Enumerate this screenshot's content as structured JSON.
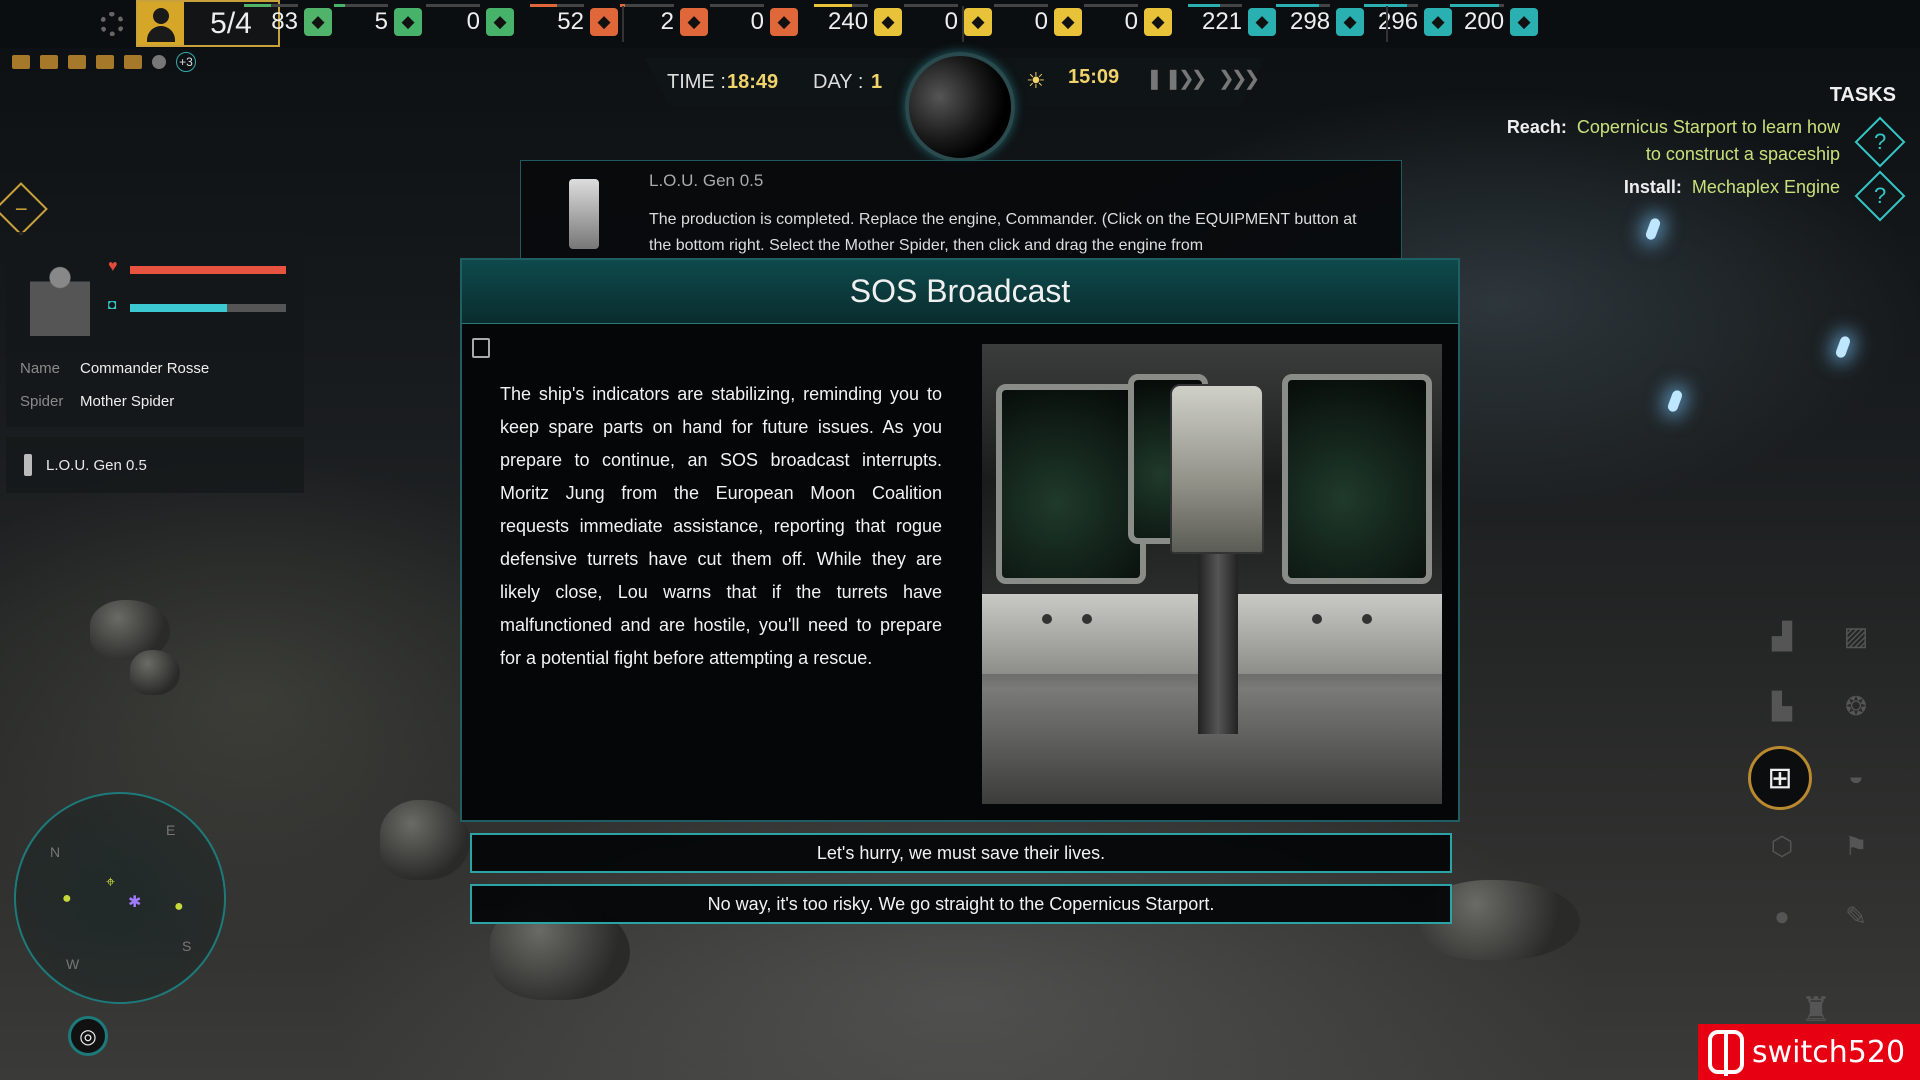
{
  "topbar": {
    "population": "5/4",
    "resources": [
      {
        "value": "83",
        "icon": "worker-icon",
        "color": "#4fb36a",
        "fill": 0.5
      },
      {
        "value": "5",
        "icon": "food-icon",
        "color": "#47b36a",
        "fill": 0.2
      },
      {
        "value": "0",
        "icon": "seed-icon",
        "color": "#47b36a",
        "fill": 0.0
      },
      {
        "value": "52",
        "icon": "ore-icon",
        "color": "#e0673a",
        "fill": 0.5
      },
      {
        "value": "2",
        "icon": "mineral-icon",
        "color": "#e0673a",
        "fill": 0.1
      },
      {
        "value": "0",
        "icon": "crystal-icon",
        "color": "#e0673a",
        "fill": 0.0
      },
      {
        "value": "240",
        "icon": "metal-icon",
        "color": "#e8c33a",
        "fill": 0.7
      },
      {
        "value": "0",
        "icon": "radiation-icon",
        "color": "#e8c33a",
        "fill": 0.0
      },
      {
        "value": "0",
        "icon": "tool-icon",
        "color": "#e8c33a",
        "fill": 0.0
      },
      {
        "value": "0",
        "icon": "cargo-icon",
        "color": "#e8c33a",
        "fill": 0.0
      },
      {
        "value": "221",
        "icon": "pipe-icon",
        "color": "#2ab0b0",
        "fill": 0.6
      },
      {
        "value": "298",
        "icon": "water-icon",
        "color": "#2ab0b0",
        "fill": 0.8
      },
      {
        "value": "296",
        "icon": "repair-icon",
        "color": "#2ab0b0",
        "fill": 0.8
      },
      {
        "value": "200",
        "icon": "battery-icon",
        "color": "#2ab0b0",
        "fill": 0.9
      }
    ],
    "notifications_more": "+3"
  },
  "time": {
    "time_label": "TIME :",
    "time_value": "18:49",
    "day_label": "DAY :",
    "day_value": "1",
    "sun_time": "15:09"
  },
  "tasks": {
    "title": "TASKS",
    "items": [
      {
        "key": "Reach:",
        "value": "Copernicus Starport to learn how",
        "value2": "to construct a spaceship"
      },
      {
        "key": "Install:",
        "value": "Mechaplex Engine"
      }
    ]
  },
  "character": {
    "hp": 1.0,
    "shield": 0.62,
    "name_label": "Name",
    "name_value": "Commander Rosse",
    "spider_label": "Spider",
    "spider_value": "Mother Spider",
    "unit": "L.O.U. Gen 0.5"
  },
  "preview": {
    "title": "L.O.U. Gen 0.5",
    "text": "The production is completed. Replace the engine, Commander. (Click on the EQUIPMENT button at the bottom right. Select the Mother Spider, then click and drag the engine from"
  },
  "dialog": {
    "title": "SOS Broadcast",
    "text": "The ship's indicators are stabilizing, reminding you to keep spare parts on hand for future issues. As you prepare to continue, an SOS broadcast interrupts. Moritz Jung from the European Moon Coalition requests immediate assistance, reporting that rogue defensive turrets have cut them off. While they are likely close, Lou warns that if the turrets have malfunctioned and are hostile, you'll need to prepare for a potential fight before attempting a rescue.",
    "choice1": "Let's hurry, we must save their lives.",
    "choice2": "No way, it's too risky. We go straight to the Copernicus Starport."
  },
  "compass": {
    "n": "N",
    "e": "E",
    "s": "S",
    "w": "W"
  },
  "watermark": "switch520"
}
